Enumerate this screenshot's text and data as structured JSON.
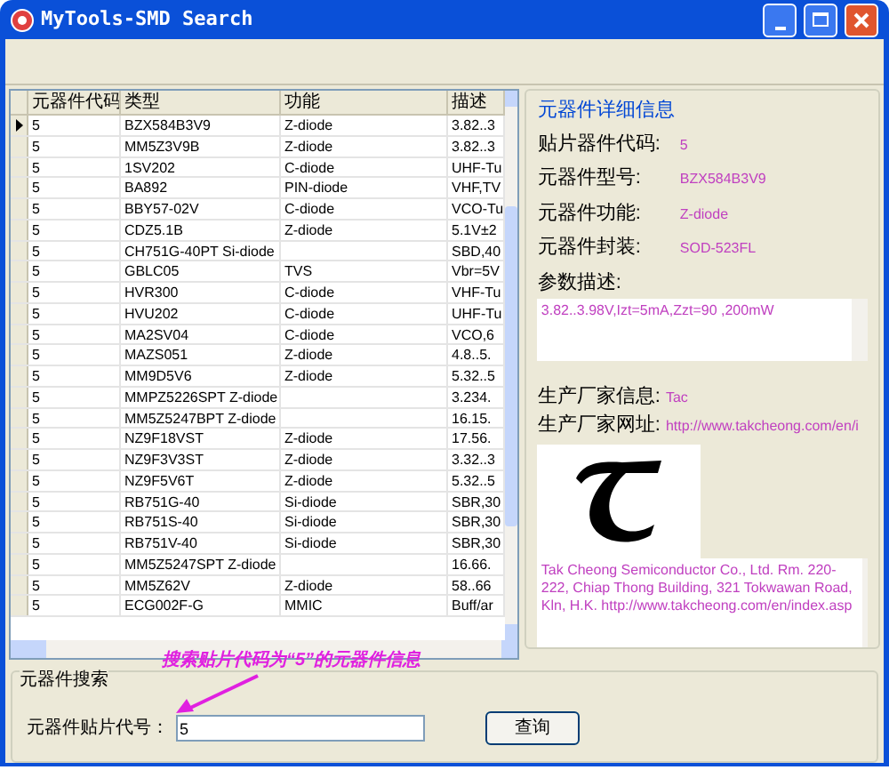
{
  "window": {
    "title": "MyTools-SMD Search"
  },
  "table": {
    "columns": [
      "元器件代码",
      "类型",
      "功能",
      "描述"
    ],
    "rows": [
      {
        "selected": true,
        "code": "5",
        "type": "BZX584B3V9",
        "function": "Z-diode",
        "description": "3.82..3"
      },
      {
        "selected": false,
        "code": "5",
        "type": "MM5Z3V9B",
        "function": "Z-diode",
        "description": "3.82..3"
      },
      {
        "selected": false,
        "code": "5",
        "type": "1SV202",
        "function": "C-diode",
        "description": "UHF-Tu"
      },
      {
        "selected": false,
        "code": "5",
        "type": "BA892",
        "function": "PIN-diode",
        "description": "VHF,TV"
      },
      {
        "selected": false,
        "code": "5",
        "type": "BBY57-02V",
        "function": "C-diode",
        "description": "VCO-Tu"
      },
      {
        "selected": false,
        "code": "5",
        "type": "CDZ5.1B",
        "function": "Z-diode",
        "description": "5.1V±2"
      },
      {
        "selected": false,
        "code": "5",
        "type": "CH751G-40PT Si-diode",
        "description": "SBD,40"
      },
      {
        "selected": false,
        "code": "5",
        "type": "GBLC05",
        "function": "TVS",
        "description": "Vbr=5V"
      },
      {
        "selected": false,
        "code": "5",
        "type": "HVR300",
        "function": "C-diode",
        "description": "VHF-Tu"
      },
      {
        "selected": false,
        "code": "5",
        "type": "HVU202",
        "function": "C-diode",
        "description": "UHF-Tu"
      },
      {
        "selected": false,
        "code": "5",
        "type": "MA2SV04",
        "function": "C-diode",
        "description": "VCO,6"
      },
      {
        "selected": false,
        "code": "5",
        "type": "MAZS051",
        "function": "Z-diode",
        "description": "4.8..5."
      },
      {
        "selected": false,
        "code": "5",
        "type": "MM9D5V6",
        "function": "Z-diode",
        "description": "5.32..5"
      },
      {
        "selected": false,
        "code": "5",
        "type": "MMPZ5226SPT Z-diode",
        "description": "3.234."
      },
      {
        "selected": false,
        "code": "5",
        "type": "MM5Z5247BPT Z-diode",
        "description": "16.15."
      },
      {
        "selected": false,
        "code": "5",
        "type": "NZ9F18VST",
        "function": "Z-diode",
        "description": "17.56."
      },
      {
        "selected": false,
        "code": "5",
        "type": "NZ9F3V3ST",
        "function": "Z-diode",
        "description": "3.32..3"
      },
      {
        "selected": false,
        "code": "5",
        "type": "NZ9F5V6T",
        "function": "Z-diode",
        "description": "5.32..5"
      },
      {
        "selected": false,
        "code": "5",
        "type": "RB751G-40",
        "function": "Si-diode",
        "description": "SBR,30"
      },
      {
        "selected": false,
        "code": "5",
        "type": "RB751S-40",
        "function": "Si-diode",
        "description": "SBR,30"
      },
      {
        "selected": false,
        "code": "5",
        "type": "RB751V-40",
        "function": "Si-diode",
        "description": "SBR,30"
      },
      {
        "selected": false,
        "code": "5",
        "type": "MM5Z5247SPT Z-diode",
        "description": "16.66."
      },
      {
        "selected": false,
        "code": "5",
        "type": "MM5Z62V",
        "function": "Z-diode",
        "description": "58..66"
      },
      {
        "selected": false,
        "code": "5",
        "type": "ECG002F-G",
        "function": "MMIC",
        "description": "Buff/ar"
      }
    ]
  },
  "details": {
    "title": "元器件详细信息",
    "fields": [
      {
        "label": "贴片器件代码:",
        "value": "5"
      },
      {
        "label": "元器件型号:",
        "value": "BZX584B3V9"
      },
      {
        "label": "元器件功能:",
        "value": "Z-diode"
      },
      {
        "label": "元器件封装:",
        "value": "SOD-523FL"
      }
    ],
    "description_label": "参数描述:",
    "description_text": "3.82..3.98V,Izt=5mA,Zzt=90 ,200mW",
    "manufacturer_label": "生产厂家信息:",
    "manufacturer_value": "Tac",
    "website_label": "生产厂家网址:",
    "website_value": "http://www.takcheong.com/en/i",
    "address": "Tak Cheong Semiconductor Co., Ltd. Rm. 220-222, Chiap Thong Building, 321 Tokwawan Road, Kln, H.K. http://www.takcheong.com/en/index.asp"
  },
  "search": {
    "title": "元器件搜索",
    "annotation": "搜索贴片代码为“5”的元器件信息",
    "field_label": "元器件贴片代号：",
    "value": "5",
    "button": "查询"
  }
}
